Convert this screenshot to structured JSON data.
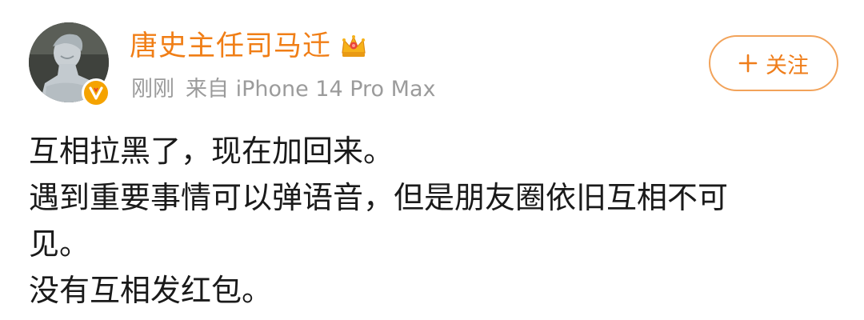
{
  "post": {
    "author": {
      "name": "唐史主任司马迁",
      "avatar_icon": "statue-avatar",
      "badge_icon": "verified-v-icon",
      "badge_color": "#f5a300",
      "name_color": "#f07e16",
      "crown_icon": "crown-icon"
    },
    "meta": {
      "time": "刚刚",
      "source": "来自 iPhone 14 Pro Max"
    },
    "follow_button": {
      "label": "关注",
      "icon": "plus-icon",
      "color": "#ef7d1a"
    },
    "lines": [
      "互相拉黑了，现在加回来。",
      "遇到重要事情可以弹语音，但是朋友圈依旧互相不可",
      "见。",
      "没有互相发红包。"
    ]
  }
}
